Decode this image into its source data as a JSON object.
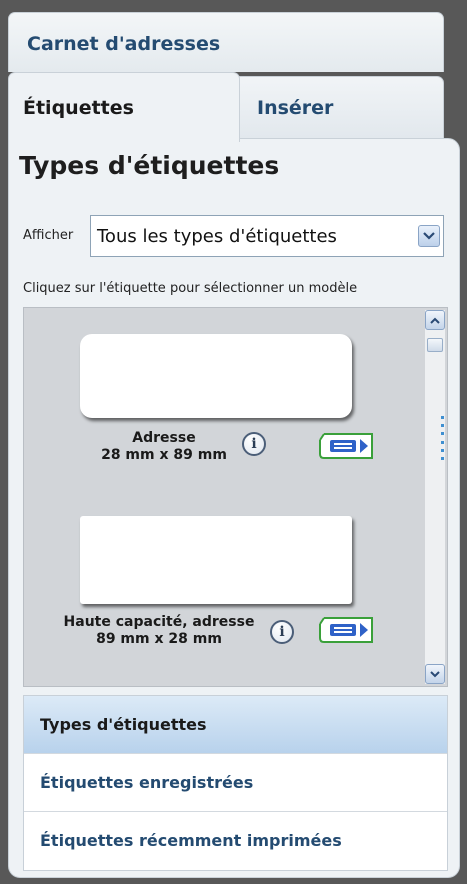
{
  "tabs": {
    "address_book": "Carnet d'adresses",
    "labels": "Étiquettes",
    "insert": "Insérer"
  },
  "section": {
    "title": "Types d'étiquettes"
  },
  "filter": {
    "label": "Afficher",
    "selected": "Tous les types d'étiquettes"
  },
  "hint": "Cliquez sur l'étiquette pour sélectionner un modèle",
  "gallery": {
    "items": [
      {
        "name": "Adresse",
        "size": "28 mm x 89 mm"
      },
      {
        "name": "Haute capacité, adresse",
        "size": "89 mm x 28 mm"
      }
    ]
  },
  "nav": {
    "items": [
      {
        "label": "Types d'étiquettes",
        "active": true
      },
      {
        "label": "Étiquettes enregistrées",
        "active": false
      },
      {
        "label": "Étiquettes récemment imprimées",
        "active": false
      }
    ]
  },
  "colors": {
    "accent": "#244b71",
    "panel": "#eef2f5",
    "active_nav": "#c9ddf1",
    "background": "#585858"
  },
  "icons": [
    "info-icon",
    "print-label-icon",
    "chevron-down-icon",
    "chevron-up-icon"
  ]
}
